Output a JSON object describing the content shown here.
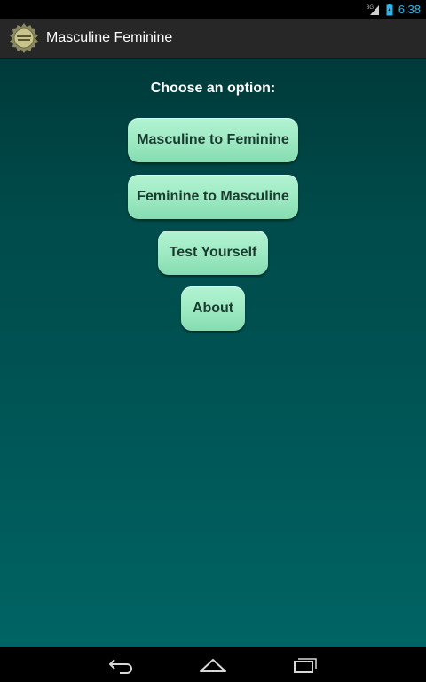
{
  "status_bar": {
    "network_label": "3G",
    "time": "6:38"
  },
  "action_bar": {
    "title": "Masculine Feminine",
    "logo_icon": "app-logo-icon",
    "logo_text": "Masculine Feminine"
  },
  "main": {
    "prompt": "Choose an option:",
    "buttons": [
      {
        "label": "Masculine to Feminine"
      },
      {
        "label": "Feminine to Masculine"
      },
      {
        "label": "Test Yourself"
      },
      {
        "label": "About"
      }
    ]
  },
  "nav_bar": {
    "back_icon": "back-icon",
    "home_icon": "home-icon",
    "recents_icon": "recents-icon"
  },
  "colors": {
    "status_time": "#33b5e5",
    "action_bar": "#272727",
    "content_top": "#003a3a",
    "content_bottom": "#006464",
    "button_fill": "#9eeac3",
    "button_text": "#1c3b30"
  }
}
